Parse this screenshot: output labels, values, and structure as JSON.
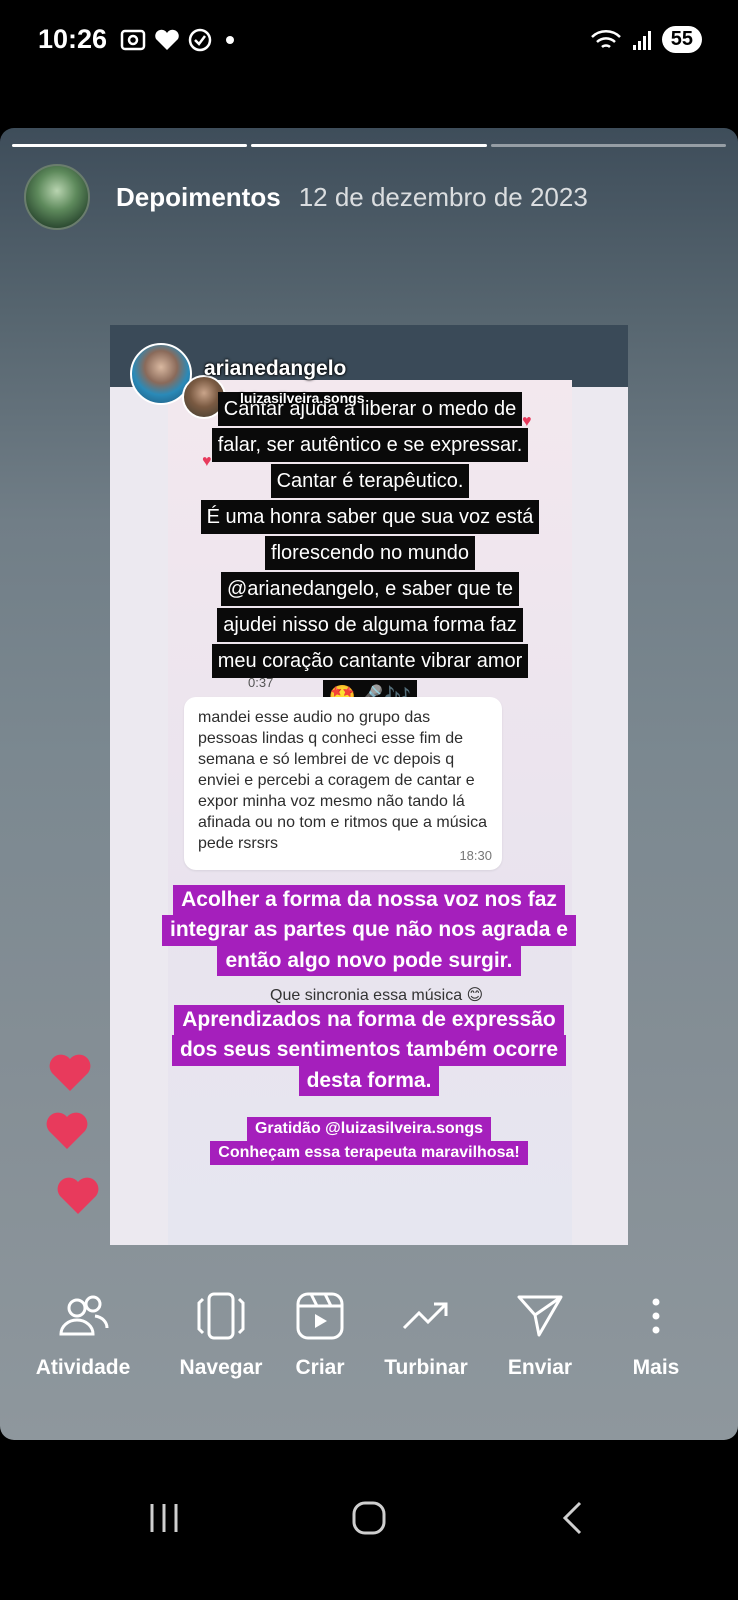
{
  "status_bar": {
    "time": "10:26",
    "battery": "55"
  },
  "story": {
    "username": "Depoimentos",
    "date": "12 de dezembro de 2023"
  },
  "inner": {
    "user1": "arianedangelo",
    "user2": "luizasilveira.songs",
    "black_lines": [
      "Cantar ajuda a liberar o medo de",
      "falar, ser autêntico e se expressar.",
      "Cantar é terapêutico.",
      "É uma honra saber que sua voz está",
      "florescendo no mundo",
      "@arianedangelo, e saber que te",
      "ajudei nisso de alguma forma faz",
      "meu coração cantante vibrar amor"
    ],
    "emojis": "🤩🎤🎶",
    "audio_time": "0:37",
    "message": "mandei esse audio no grupo das pessoas lindas q conheci esse fim de semana e só lembrei de vc  depois q enviei  e percebi a coragem de cantar e expor minha voz mesmo não tando lá afinada ou no tom e ritmos que a música pede rsrsrs",
    "message_time": "18:30",
    "purple1": [
      "Acolher a forma da nossa voz nos faz",
      "integrar as partes que não nos agrada e",
      "então algo novo pode surgir."
    ],
    "sync_text": "Que sincronia essa música 😊",
    "purple2": [
      "Aprendizados na forma de expressão",
      "dos seus sentimentos também ocorre",
      "desta forma."
    ],
    "purple3": [
      "Gratidão @luizasilveira.songs",
      "Conheçam essa terapeuta maravilhosa!"
    ]
  },
  "actions": [
    {
      "label": "Atividade",
      "icon": "people-icon"
    },
    {
      "label": "Navegar",
      "icon": "pages-icon"
    },
    {
      "label": "Criar",
      "icon": "reels-icon"
    },
    {
      "label": "Turbinar",
      "icon": "trending-icon"
    },
    {
      "label": "Enviar",
      "icon": "send-icon"
    },
    {
      "label": "Mais",
      "icon": "more-vertical-icon"
    }
  ],
  "colors": {
    "purple_highlight": "#a51fbc",
    "heart": "#e83a5c"
  }
}
